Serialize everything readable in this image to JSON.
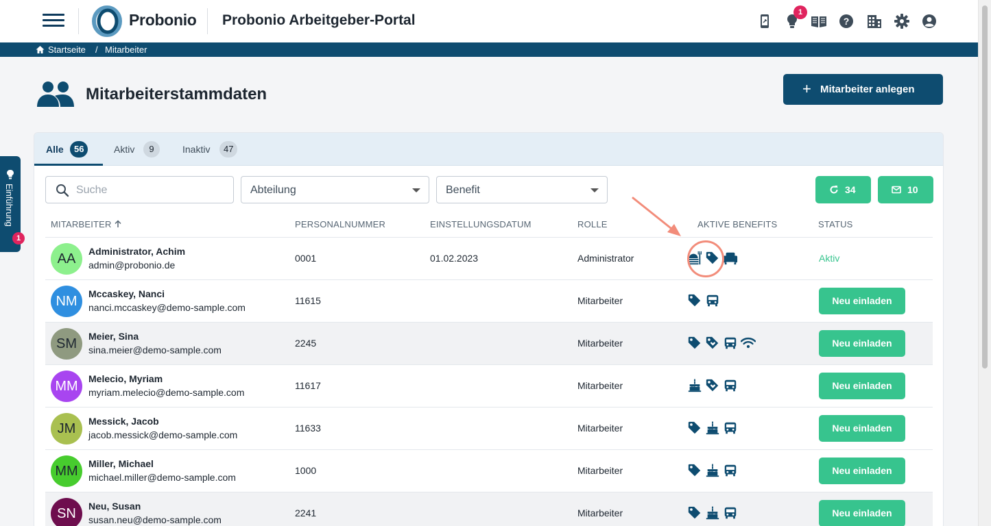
{
  "header": {
    "logo_text": "Probonio",
    "portal_title": "Probonio Arbeitgeber-Portal",
    "notification_count": "1",
    "icons": [
      "mobile-icon",
      "lightbulb-icon",
      "book-icon",
      "help-icon",
      "company-icon",
      "gear-icon",
      "user-circle-icon"
    ]
  },
  "breadcrumb": {
    "home": "Startseite",
    "separator": "/",
    "current": "Mitarbeiter"
  },
  "page": {
    "title": "Mitarbeiterstammdaten",
    "add_button": "Mitarbeiter anlegen"
  },
  "side_tab": {
    "label": "Einführung",
    "badge": "1"
  },
  "tabs": [
    {
      "label": "Alle",
      "count": "56",
      "active": true
    },
    {
      "label": "Aktiv",
      "count": "9",
      "active": false
    },
    {
      "label": "Inaktiv",
      "count": "47",
      "active": false
    }
  ],
  "filters": {
    "search_placeholder": "Suche",
    "department_label": "Abteilung",
    "benefit_label": "Benefit",
    "refresh_count": "34",
    "mail_count": "10"
  },
  "table": {
    "headers": {
      "employee": "MITARBEITER",
      "personnel_number": "PERSONALNUMMER",
      "hire_date": "EINSTELLUNGSDATUM",
      "role": "ROLLE",
      "benefits": "AKTIVE BENEFITS",
      "status": "STATUS"
    },
    "invite_label": "Neu einladen",
    "rows": [
      {
        "initials": "AA",
        "name": "Administrator, Achim",
        "email": "admin@probonio.de",
        "number": "0001",
        "date": "01.02.2023",
        "role": "Administrator",
        "benefits": [
          "meal-icon",
          "tag-icon",
          "armchair-icon"
        ],
        "status": "Aktiv",
        "avatar_color": "#8df08d"
      },
      {
        "initials": "NM",
        "name": "Mccaskey, Nanci",
        "email": "nanci.mccaskey@demo-sample.com",
        "number": "11615",
        "date": "",
        "role": "Mitarbeiter",
        "benefits": [
          "tag-icon",
          "bus-icon"
        ],
        "status": "",
        "avatar_color": "#2f8fe0"
      },
      {
        "initials": "SM",
        "name": "Meier, Sina",
        "email": "sina.meier@demo-sample.com",
        "number": "2245",
        "date": "",
        "role": "Mitarbeiter",
        "benefits": [
          "tag-icon",
          "gift-tag-icon",
          "bus-icon",
          "wifi-icon"
        ],
        "status": "",
        "avatar_color": "#8f9a80"
      },
      {
        "initials": "MM",
        "name": "Melecio, Myriam",
        "email": "myriam.melecio@demo-sample.com",
        "number": "11617",
        "date": "",
        "role": "Mitarbeiter",
        "benefits": [
          "cake-icon",
          "gift-tag-icon",
          "bus-icon"
        ],
        "status": "",
        "avatar_color": "#a845f0"
      },
      {
        "initials": "JM",
        "name": "Messick, Jacob",
        "email": "jacob.messick@demo-sample.com",
        "number": "11633",
        "date": "",
        "role": "Mitarbeiter",
        "benefits": [
          "tag-icon",
          "cake-icon",
          "bus-icon"
        ],
        "status": "",
        "avatar_color": "#a9c050"
      },
      {
        "initials": "MM",
        "name": "Miller, Michael",
        "email": "michael.miller@demo-sample.com",
        "number": "1000",
        "date": "",
        "role": "Mitarbeiter",
        "benefits": [
          "tag-icon",
          "cake-icon",
          "bus-icon"
        ],
        "status": "",
        "avatar_color": "#47cc2e"
      },
      {
        "initials": "SN",
        "name": "Neu, Susan",
        "email": "susan.neu@demo-sample.com",
        "number": "2241",
        "date": "",
        "role": "Mitarbeiter",
        "benefits": [
          "tag-icon",
          "cake-icon",
          "bus-icon"
        ],
        "status": "",
        "avatar_color": "#6e0e4e"
      }
    ]
  },
  "colors": {
    "primary": "#0e4c70",
    "accent": "#37c48e",
    "badge": "#e0245e",
    "annotation": "#f28c7a"
  }
}
